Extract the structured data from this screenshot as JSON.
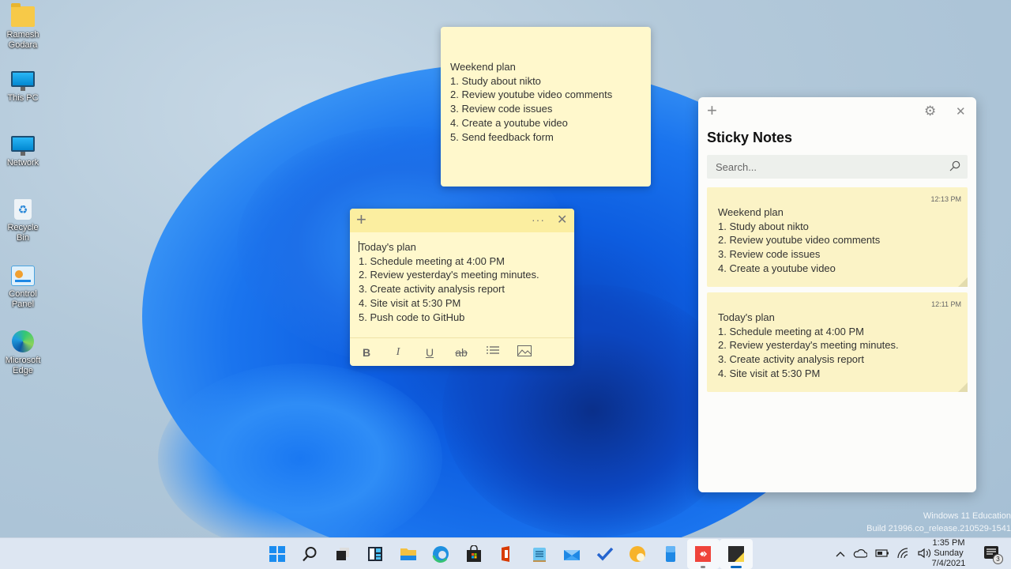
{
  "desktop": {
    "icons": [
      {
        "label_line1": "Ramesh",
        "label_line2": "Godara",
        "icon": "folder-icon"
      },
      {
        "label_line1": "This PC",
        "label_line2": "",
        "icon": "computer-icon"
      },
      {
        "label_line1": "Network",
        "label_line2": "",
        "icon": "network-icon"
      },
      {
        "label_line1": "Recycle Bin",
        "label_line2": "",
        "icon": "recycle-bin-icon"
      },
      {
        "label_line1": "Control",
        "label_line2": "Panel",
        "icon": "control-panel-icon"
      },
      {
        "label_line1": "Microsoft",
        "label_line2": "Edge",
        "icon": "edge-icon"
      }
    ]
  },
  "weekend_note": {
    "lines": [
      "Weekend plan",
      "1. Study about nikto",
      "2. Review youtube video comments",
      "3. Review code issues",
      "4. Create a youtube video",
      "5. Send feedback form"
    ]
  },
  "today_note": {
    "add_icon": "+",
    "more_icon": "···",
    "close_icon": "✕",
    "lines": [
      "Today's plan",
      "1. Schedule meeting at 4:00 PM",
      "2. Review yesterday's meeting minutes.",
      "3. Create activity analysis report",
      "4. Site visit at 5:30 PM",
      "5. Push code to GitHub"
    ],
    "toolbar": {
      "bold": "B",
      "italic": "I",
      "underline": "U",
      "strikethrough": "ab",
      "bullets": "☰",
      "image": "🖼"
    }
  },
  "sticky_app": {
    "add_icon": "+",
    "close_icon": "✕",
    "settings_icon": "⚙",
    "title": "Sticky Notes",
    "search_placeholder": "Search...",
    "notes": [
      {
        "time": "12:13 PM",
        "lines": [
          "Weekend plan",
          "1. Study about nikto",
          "2. Review youtube video comments",
          "3. Review code issues",
          "4. Create a youtube video"
        ]
      },
      {
        "time": "12:11 PM",
        "lines": [
          "Today's plan",
          "1. Schedule meeting at 4:00 PM",
          "2. Review yesterday's meeting minutes.",
          "3. Create activity analysis report",
          "4. Site visit at 5:30 PM"
        ]
      }
    ]
  },
  "watermark": {
    "line1": "Windows 11 Education",
    "line2": "Build 21996.co_release.210529-1541"
  },
  "taskbar": {
    "apps": [
      "start",
      "search",
      "task-view",
      "widgets",
      "file-explorer",
      "edge",
      "store",
      "office",
      "notepad",
      "mail",
      "todo",
      "photos",
      "phone",
      "anydesk",
      "sticky-notes"
    ],
    "tray": {
      "chevron": "^",
      "clock_time": "1:35 PM",
      "clock_day": "Sunday",
      "clock_date": "7/4/2021",
      "notification_count": "3"
    }
  },
  "colors": {
    "note_bg": "#fff8cc",
    "note_header": "#fbeea0",
    "card_bg": "#fbf3c6",
    "taskbar_bg": "#dde6f2",
    "accent": "#0067c0"
  }
}
